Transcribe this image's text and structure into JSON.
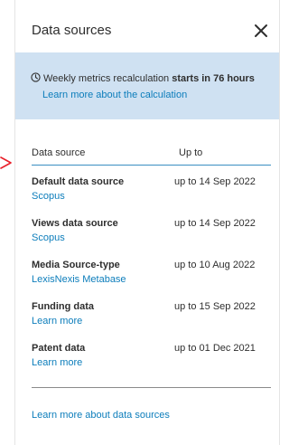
{
  "panel": {
    "title": "Data sources",
    "close_icon": "close-icon"
  },
  "notice": {
    "icon": "clock-icon",
    "text_prefix": "Weekly metrics recalculation ",
    "text_bold": "starts in 76 hours",
    "link": "Learn more about the calculation"
  },
  "table": {
    "headers": {
      "source": "Data source",
      "upto": "Up to"
    },
    "rows": [
      {
        "name": "Default data source",
        "link": "Scopus",
        "date": "up to 14 Sep 2022"
      },
      {
        "name": "Views data source",
        "link": "Scopus",
        "date": "up to 14 Sep 2022"
      },
      {
        "name": "Media Source-type",
        "link": "LexisNexis Metabase",
        "date": "up to 10 Aug 2022"
      },
      {
        "name": "Funding data",
        "link": "Learn more",
        "date": "up to 15 Sep 2022"
      },
      {
        "name": "Patent data",
        "link": "Learn more",
        "date": "up to 01 Dec 2021"
      }
    ]
  },
  "footer": {
    "link": "Learn more about data sources"
  },
  "colors": {
    "accent": "#0c7dbb",
    "notice_bg": "#cfe1f2",
    "pointer_arrow": "#e8202a"
  }
}
